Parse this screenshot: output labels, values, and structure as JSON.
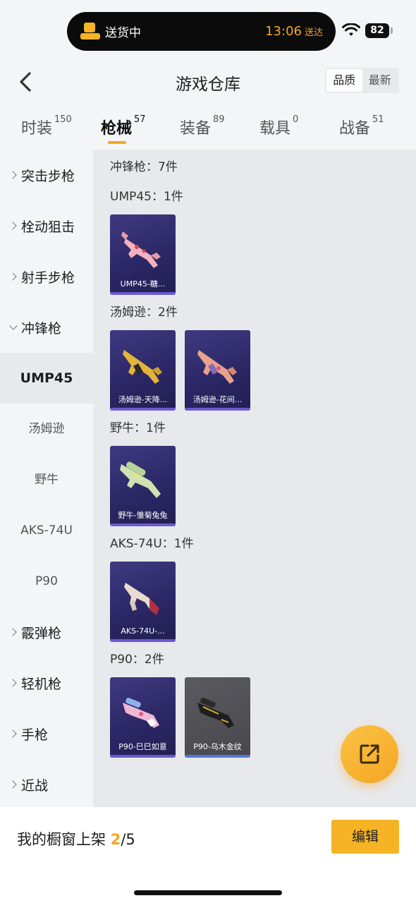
{
  "status_bar": {
    "delivery_label": "送货中",
    "time": "13:06",
    "arrive_label": "送达",
    "battery": "82"
  },
  "header": {
    "title": "游戏仓库",
    "sort_options": [
      "品质",
      "最新"
    ]
  },
  "tabs": [
    {
      "label": "时装",
      "count": "150"
    },
    {
      "label": "枪械",
      "count": "57"
    },
    {
      "label": "装备",
      "count": "89"
    },
    {
      "label": "载具",
      "count": "0"
    },
    {
      "label": "战备",
      "count": "51"
    }
  ],
  "sidebar": {
    "items": [
      {
        "label": "突击步枪"
      },
      {
        "label": "栓动狙击"
      },
      {
        "label": "射手步枪"
      },
      {
        "label": "冲锋枪"
      }
    ],
    "subitems": [
      {
        "label": "UMP45"
      },
      {
        "label": "汤姆逊"
      },
      {
        "label": "野牛"
      },
      {
        "label": "AKS-74U"
      },
      {
        "label": "P90"
      }
    ],
    "items_after": [
      {
        "label": "霰弹枪"
      },
      {
        "label": "轻机枪"
      },
      {
        "label": "手枪"
      },
      {
        "label": "近战"
      }
    ]
  },
  "content": {
    "category_heading": "冲锋枪：7件",
    "groups": [
      {
        "heading": "UMP45：1件",
        "items": [
          {
            "name": "UMP45-糖..."
          }
        ]
      },
      {
        "heading": "汤姆逊：2件",
        "items": [
          {
            "name": "汤姆逊-天降..."
          },
          {
            "name": "汤姆逊-花间..."
          }
        ]
      },
      {
        "heading": "野牛：1件",
        "items": [
          {
            "name": "野牛-雏菊兔兔"
          }
        ]
      },
      {
        "heading": "AKS-74U：1件",
        "items": [
          {
            "name": "AKS-74U-..."
          }
        ]
      },
      {
        "heading": "P90：2件",
        "items": [
          {
            "name": "P90-巳巳如意"
          },
          {
            "name": "P90-乌木金纹"
          }
        ]
      }
    ]
  },
  "bottom_bar": {
    "showcase_prefix": "我的橱窗上架",
    "showcase_count": "2",
    "showcase_total": "/5",
    "edit_label": "编辑"
  },
  "colors": {
    "accent": "#f5a623",
    "card_purple": "#2c2766",
    "card_gray": "#4d4d52"
  }
}
